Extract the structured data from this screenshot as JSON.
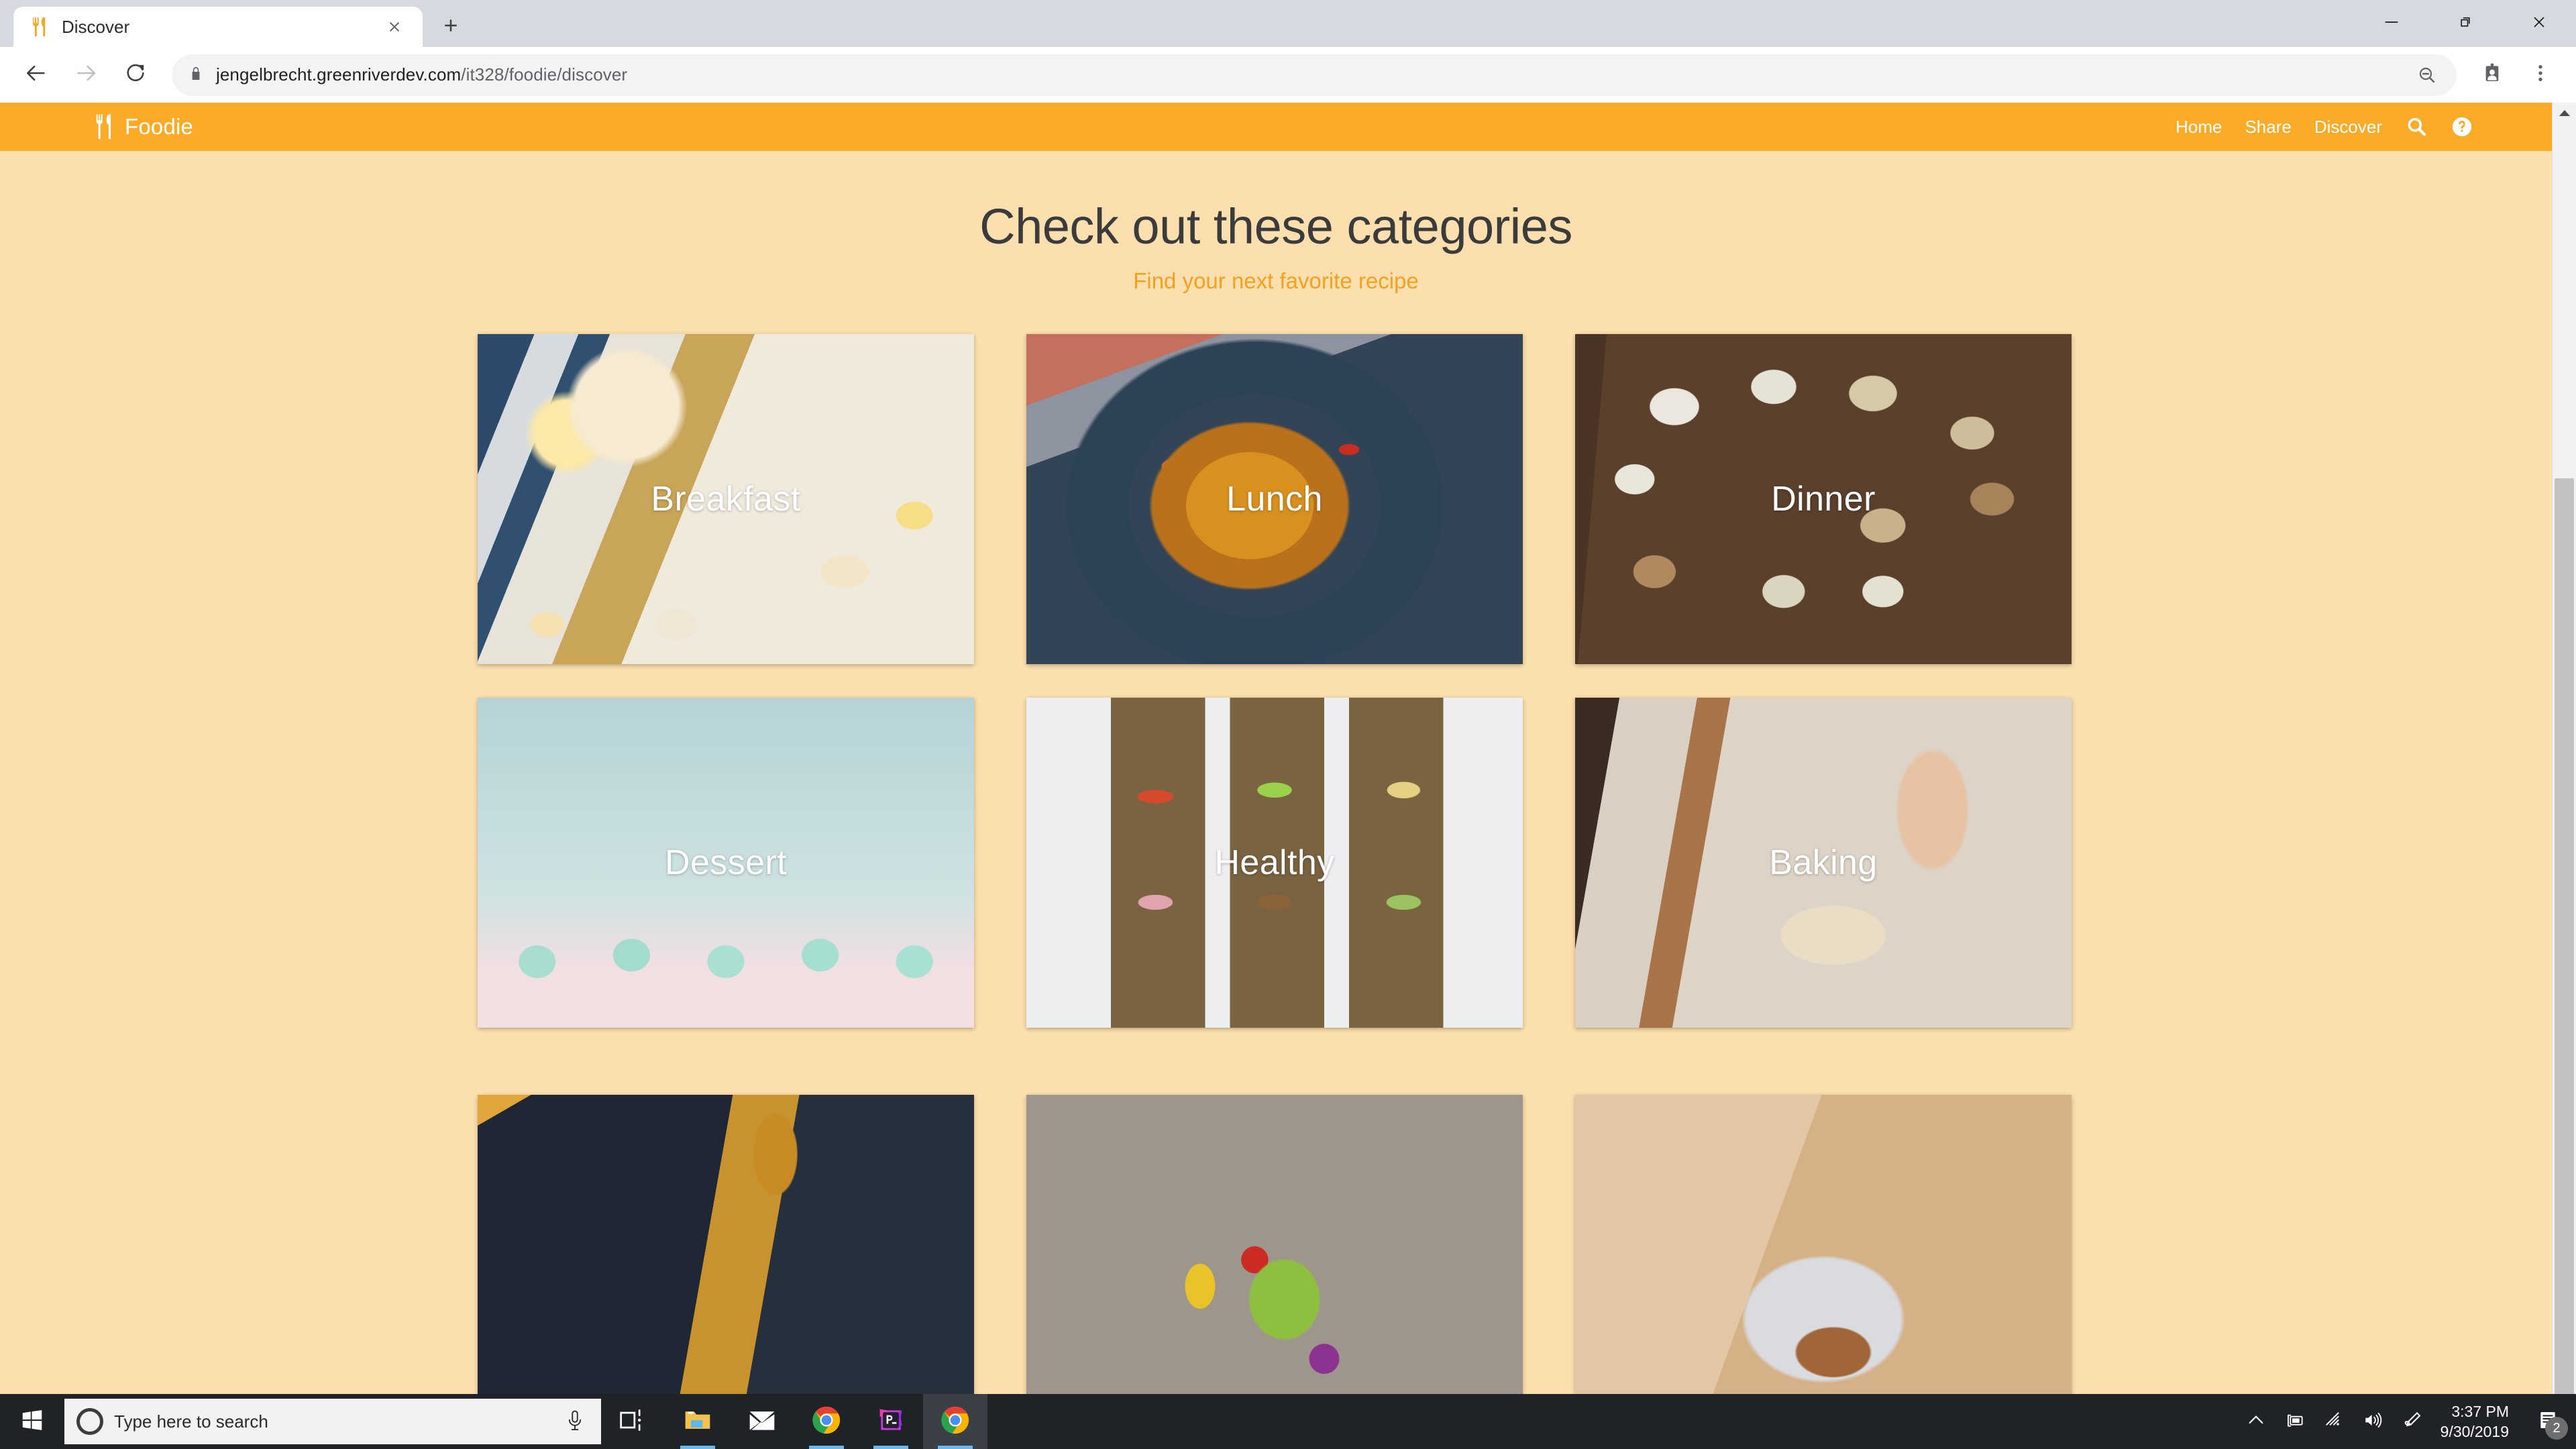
{
  "browser": {
    "tab": {
      "title": "Discover",
      "favicon_icon": "fork-knife-icon",
      "close_icon": "close-icon"
    },
    "newtab_icon": "plus-icon",
    "window_controls": {
      "minimize_icon": "minimize-icon",
      "restore_icon": "restore-icon",
      "close_icon": "close-icon"
    },
    "toolbar": {
      "back_icon": "arrow-left-icon",
      "forward_icon": "arrow-right-icon",
      "reload_icon": "reload-icon",
      "lock_icon": "lock-icon",
      "url_domain": "jengelbrecht.greenriverdev.com",
      "url_path": "/it328/foodie/discover",
      "zoom_out_icon": "zoom-out-icon",
      "profile_icon": "profile-badge-icon",
      "menu_icon": "three-dot-menu-icon"
    },
    "scrollbar": {
      "up_arrow_icon": "chevron-up-icon"
    }
  },
  "site": {
    "nav": {
      "brand": "Foodie",
      "brand_icon": "fork-knife-icon",
      "links": [
        {
          "label": "Home"
        },
        {
          "label": "Share"
        },
        {
          "label": "Discover"
        }
      ],
      "search_icon": "search-icon",
      "help_icon": "help-circle-icon",
      "background_color": "#fbab27"
    },
    "page_background_color": "#fcdfae",
    "heading": "Check out these categories",
    "subheading": "Find your next favorite recipe",
    "subheading_color": "#f5a11f",
    "categories": [
      {
        "label": "Breakfast",
        "photo": "breakfast-spread-photo"
      },
      {
        "label": "Lunch",
        "photo": "paella-pot-photo"
      },
      {
        "label": "Dinner",
        "photo": "dinner-table-photo"
      },
      {
        "label": "Dessert",
        "photo": "cupcakes-photo"
      },
      {
        "label": "Healthy",
        "photo": "open-toasts-photo"
      },
      {
        "label": "Baking",
        "photo": "kneading-dough-photo"
      },
      {
        "label": "",
        "photo": "drink-pour-photo"
      },
      {
        "label": "",
        "photo": "salad-bowl-photo"
      },
      {
        "label": "",
        "photo": "nuts-bowl-photo"
      }
    ]
  },
  "taskbar": {
    "start_icon": "windows-start-icon",
    "search_placeholder": "Type here to search",
    "cortana_icon": "cortana-circle-icon",
    "mic_icon": "microphone-icon",
    "apps": [
      {
        "name": "task-view",
        "icon": "task-view-icon"
      },
      {
        "name": "file-explorer",
        "icon": "folder-icon"
      },
      {
        "name": "mail",
        "icon": "envelope-icon"
      },
      {
        "name": "chrome",
        "icon": "chrome-icon"
      },
      {
        "name": "photoshop",
        "icon": "photoshop-icon"
      },
      {
        "name": "chrome-active",
        "icon": "chrome-icon"
      }
    ],
    "tray": [
      {
        "name": "show-hidden-icons",
        "icon": "chevron-up-icon"
      },
      {
        "name": "battery",
        "icon": "battery-charging-icon"
      },
      {
        "name": "network",
        "icon": "wifi-icon"
      },
      {
        "name": "volume",
        "icon": "speaker-icon"
      },
      {
        "name": "pen",
        "icon": "pen-icon"
      }
    ],
    "clock": {
      "time": "3:37 PM",
      "date": "9/30/2019"
    },
    "action_center": {
      "icon": "notification-icon",
      "badge": "2"
    }
  }
}
